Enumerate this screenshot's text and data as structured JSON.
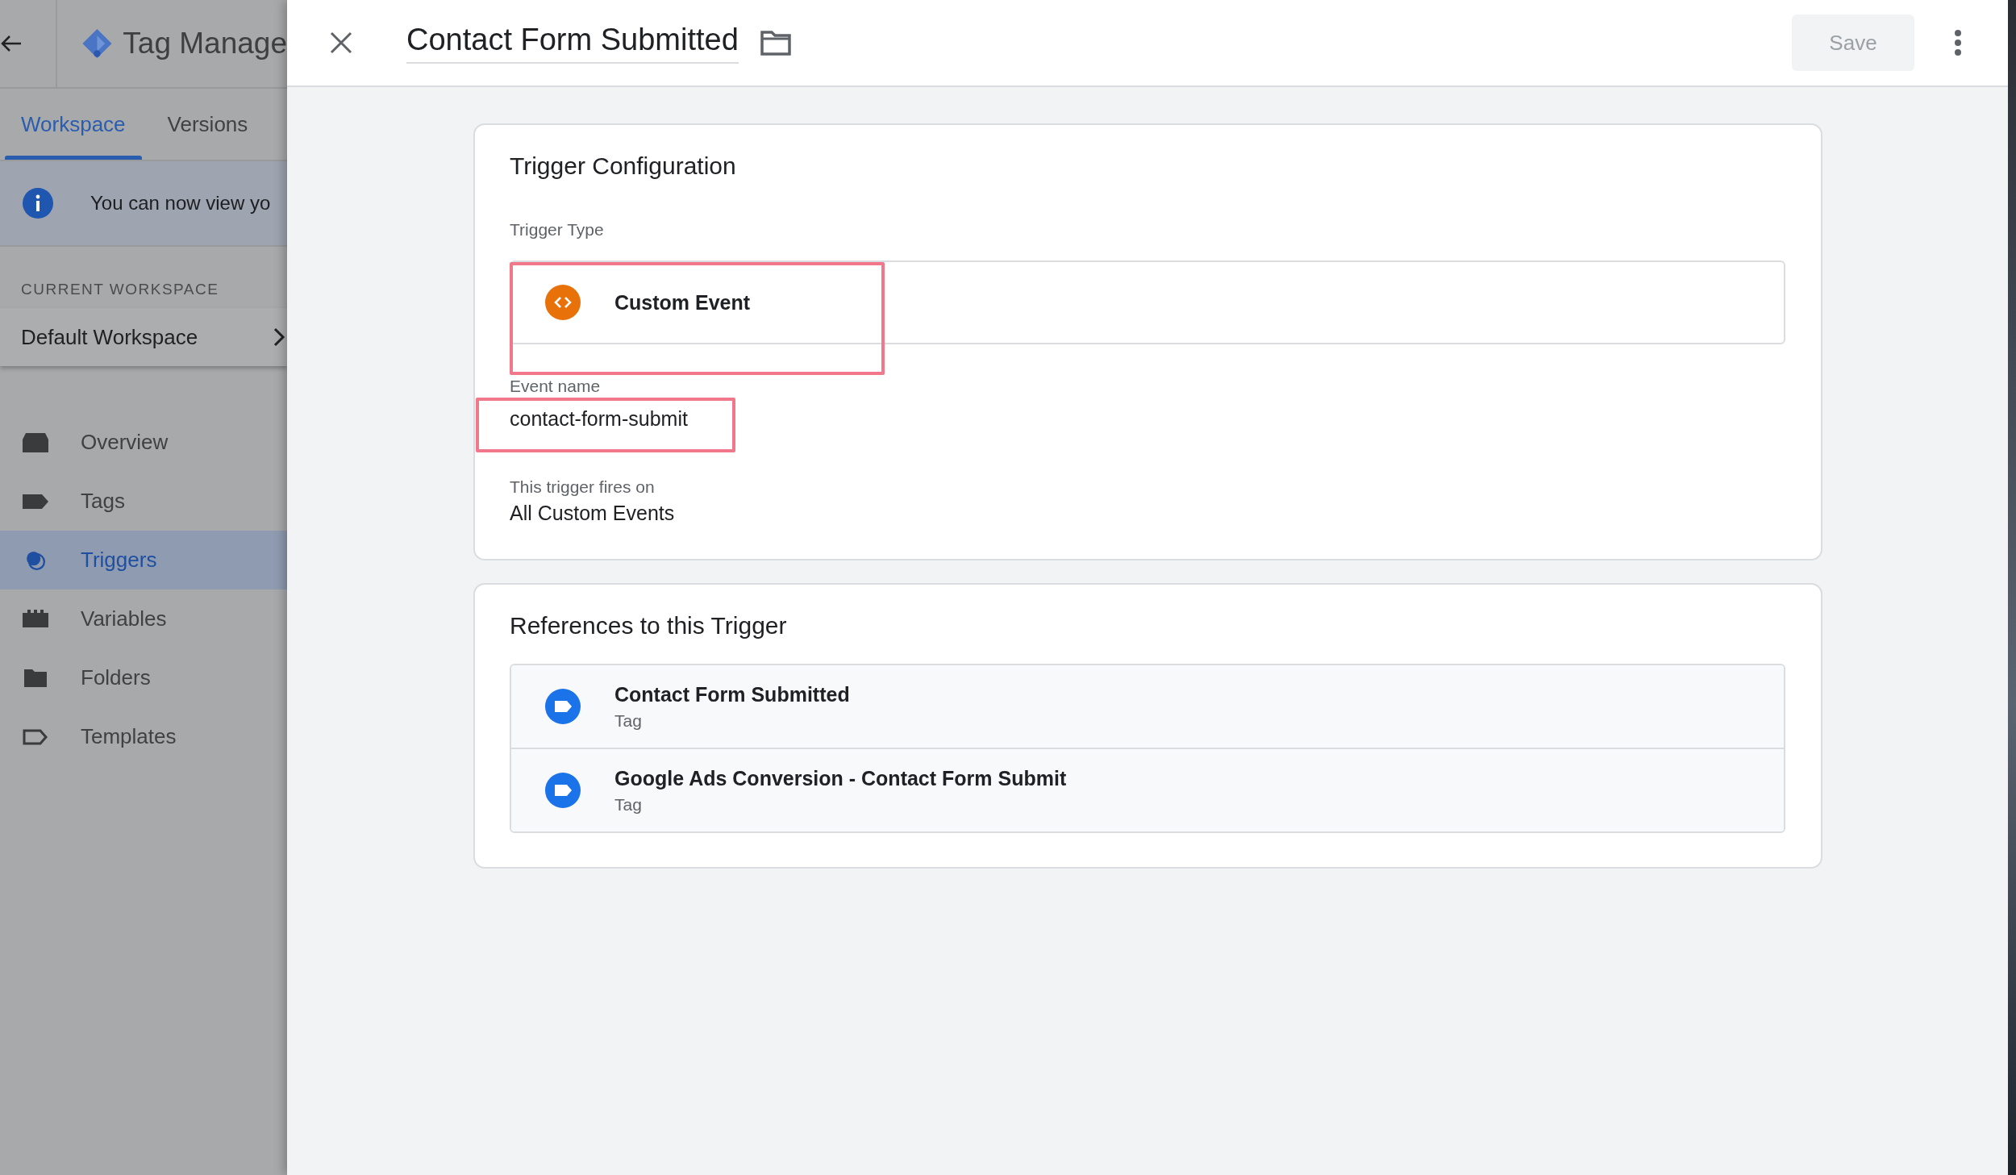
{
  "sidebar": {
    "product_title": "Tag Manage",
    "tabs": [
      {
        "label": "Workspace",
        "selected": true
      },
      {
        "label": "Versions",
        "selected": false
      }
    ],
    "banner": "You can now view yo",
    "workspace_label": "CURRENT WORKSPACE",
    "workspace": "Default Workspace",
    "nav": [
      {
        "label": "Overview",
        "kind": "overview",
        "selected": false
      },
      {
        "label": "Tags",
        "kind": "tag",
        "selected": false
      },
      {
        "label": "Triggers",
        "kind": "trigger",
        "selected": true
      },
      {
        "label": "Variables",
        "kind": "variable",
        "selected": false
      },
      {
        "label": "Folders",
        "kind": "folder",
        "selected": false
      },
      {
        "label": "Templates",
        "kind": "template",
        "selected": false
      }
    ]
  },
  "panel": {
    "title": "Contact Form Submitted",
    "save": {
      "label": "Save",
      "disabled": true
    },
    "config": {
      "heading": "Trigger Configuration",
      "trigger_type": {
        "label": "Trigger Type",
        "value": "Custom Event",
        "highlighted": true
      },
      "event_name": {
        "label": "Event name",
        "value": "contact-form-submit",
        "highlighted": true
      },
      "fires_on": {
        "label": "This trigger fires on",
        "value": "All Custom Events"
      }
    },
    "references": {
      "heading": "References to this Trigger",
      "items": [
        {
          "name": "Contact Form Submitted",
          "type": "Tag"
        },
        {
          "name": "Google Ads Conversion - Contact Form Submit",
          "type": "Tag"
        }
      ]
    }
  }
}
